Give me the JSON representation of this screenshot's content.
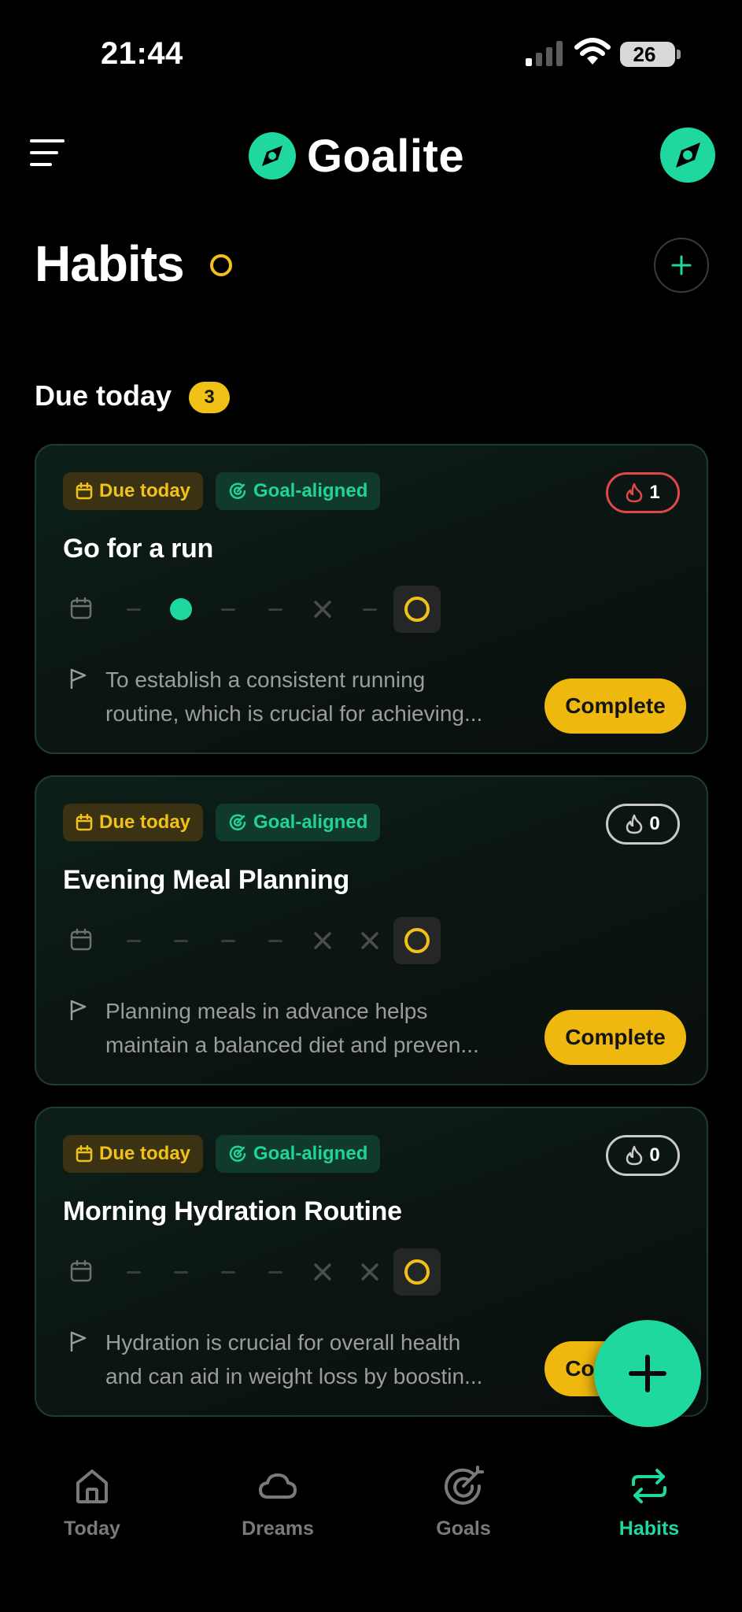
{
  "status_bar": {
    "time": "21:44",
    "battery": "26"
  },
  "header": {
    "brand": "Goalite"
  },
  "page": {
    "title": "Habits"
  },
  "section": {
    "title": "Due today",
    "count": "3"
  },
  "chips": {
    "due": "Due today",
    "goal": "Goal-aligned"
  },
  "habits": [
    {
      "title": "Go for a run",
      "streak": "1",
      "desc_line1": "To establish a consistent running",
      "desc_line2": "routine, which is crucial for achieving...",
      "action": "Complete",
      "week": [
        "dash",
        "done",
        "dash",
        "dash",
        "missed",
        "dash",
        "today"
      ]
    },
    {
      "title": "Evening Meal Planning",
      "streak": "0",
      "desc_line1": "Planning meals in advance helps",
      "desc_line2": "maintain a balanced diet and preven...",
      "action": "Complete",
      "week": [
        "dash",
        "dash",
        "dash",
        "dash",
        "missed",
        "missed",
        "today"
      ]
    },
    {
      "title": "Morning Hydration Routine",
      "streak": "0",
      "desc_line1": "Hydration is crucial for overall health",
      "desc_line2": "and can aid in weight loss by boostin...",
      "action": "Complete",
      "week": [
        "dash",
        "dash",
        "dash",
        "dash",
        "missed",
        "missed",
        "today"
      ]
    }
  ],
  "nav": [
    {
      "label": "Today",
      "icon": "home-icon"
    },
    {
      "label": "Dreams",
      "icon": "cloud-icon"
    },
    {
      "label": "Goals",
      "icon": "target-icon"
    },
    {
      "label": "Habits",
      "icon": "repeat-icon"
    }
  ],
  "colors": {
    "accent": "#1fd8a0",
    "warning": "#f2c117",
    "streak_hot": "#e04848",
    "background": "#000000"
  }
}
